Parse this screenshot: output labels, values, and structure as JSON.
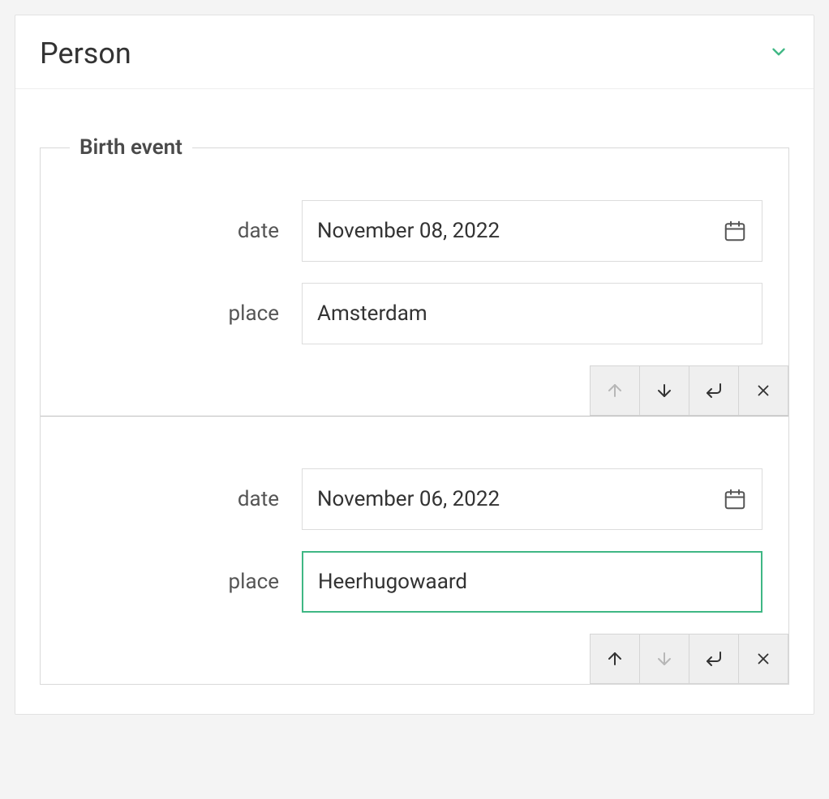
{
  "panel": {
    "title": "Person"
  },
  "fieldset": {
    "legend": "Birth event"
  },
  "labels": {
    "date": "date",
    "place": "place"
  },
  "entries": [
    {
      "date": "November 08, 2022",
      "place": "Amsterdam",
      "placeFocused": false,
      "upDisabled": true,
      "downDisabled": false
    },
    {
      "date": "November 06, 2022",
      "place": "Heerhugowaard",
      "placeFocused": true,
      "upDisabled": false,
      "downDisabled": true
    }
  ]
}
